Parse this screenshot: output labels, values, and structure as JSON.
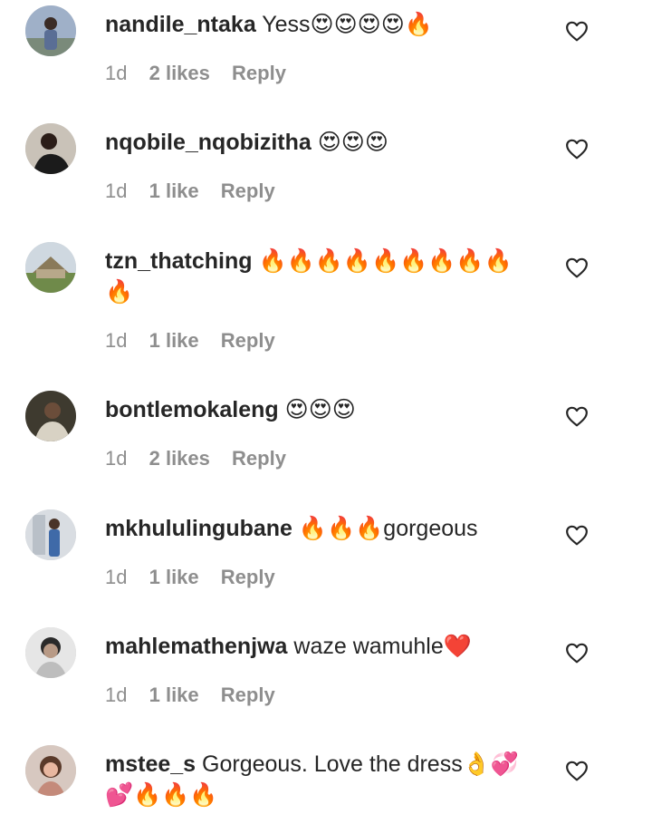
{
  "comments": [
    {
      "username": "nandile_ntaka",
      "text": "Yess😍😍😍😍🔥",
      "time": "1d",
      "likes": "2 likes",
      "reply": "Reply"
    },
    {
      "username": "nqobile_nqobizitha",
      "text": "😍😍😍",
      "time": "1d",
      "likes": "1 like",
      "reply": "Reply"
    },
    {
      "username": "tzn_thatching",
      "text": "🔥🔥🔥🔥🔥🔥🔥🔥🔥 🔥",
      "time": "1d",
      "likes": "1 like",
      "reply": "Reply"
    },
    {
      "username": "bontlemokaleng",
      "text": "😍😍😍",
      "time": "1d",
      "likes": "2 likes",
      "reply": "Reply"
    },
    {
      "username": "mkhululingubane",
      "text": "🔥🔥🔥gorgeous",
      "time": "1d",
      "likes": "1 like",
      "reply": "Reply"
    },
    {
      "username": "mahlemathenjwa",
      "text": "waze wamuhle❤️",
      "time": "1d",
      "likes": "1 like",
      "reply": "Reply"
    },
    {
      "username": "mstee_s",
      "text": "Gorgeous. Love the dress👌💞💕🔥🔥🔥",
      "time": null,
      "likes": null,
      "reply": null
    }
  ],
  "icons": {
    "like": "heart-outline-icon",
    "avatar": "profile-picture"
  },
  "colors": {
    "text": "#262626",
    "meta": "#8e8e8e",
    "heart": "#262626"
  }
}
